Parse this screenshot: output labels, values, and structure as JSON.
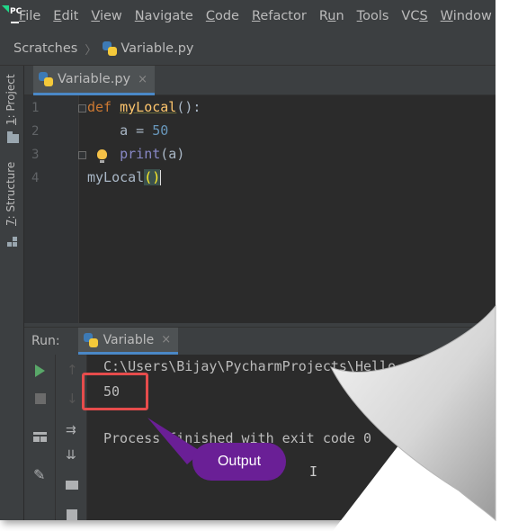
{
  "menu": {
    "items": [
      {
        "pre": "",
        "u": "F",
        "post": "ile"
      },
      {
        "pre": "",
        "u": "E",
        "post": "dit"
      },
      {
        "pre": "",
        "u": "V",
        "post": "iew"
      },
      {
        "pre": "",
        "u": "N",
        "post": "avigate"
      },
      {
        "pre": "",
        "u": "C",
        "post": "ode"
      },
      {
        "pre": "",
        "u": "R",
        "post": "efactor"
      },
      {
        "pre": "R",
        "u": "u",
        "post": "n"
      },
      {
        "pre": "",
        "u": "T",
        "post": "ools"
      },
      {
        "pre": "VC",
        "u": "S",
        "post": ""
      },
      {
        "pre": "",
        "u": "W",
        "post": "indow"
      }
    ]
  },
  "app_logo": "PC",
  "breadcrumb": {
    "project": "Scratches",
    "file": "Variable.py"
  },
  "left_strip": {
    "project_num": "1",
    "project_label": ": Project",
    "structure_num": "7",
    "structure_label": ": Structure"
  },
  "editor": {
    "tab_label": "Variable.py",
    "close_glyph": "×",
    "line_numbers": [
      "1",
      "2",
      "3",
      "4"
    ],
    "lines": {
      "l1_kw": "def ",
      "l1_fn": "myLocal",
      "l1_rest": "():",
      "l2_indent": "    ",
      "l2_var": "a = ",
      "l2_num": "50",
      "l3_indent": "    ",
      "l3_bi": "print",
      "l3_rest": "(a)",
      "l4_name": "myLocal",
      "l4_paren_open": "(",
      "l4_paren_close": ")"
    }
  },
  "run": {
    "label": "Run:",
    "tab_label": "Variable",
    "close_glyph": "×",
    "console_path": "C:\\Users\\Bijay\\PycharmProjects\\Hello",
    "output_value": "50",
    "finish_text": "Process finished with exit code 0"
  },
  "annotation": {
    "callout_text": "Output",
    "highlight_color": "#e64c4c",
    "callout_color": "#6a1f96"
  },
  "icons": [
    "pycharm-logo",
    "python-file-icon",
    "folder-icon",
    "structure-icon",
    "bulb-icon",
    "run-icon",
    "stop-icon",
    "up-arrow-icon",
    "down-arrow-icon",
    "soft-wrap-icon",
    "scroll-to-end-icon",
    "layout-icon",
    "pin-icon",
    "print-icon",
    "trash-icon"
  ]
}
